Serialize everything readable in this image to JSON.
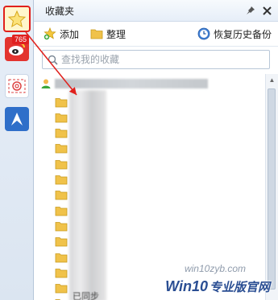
{
  "sidebar": {
    "weibo_badge": "765",
    "items": [
      {
        "name": "favorites",
        "icon": "star-icon",
        "color": "#f5c518"
      },
      {
        "name": "weibo",
        "icon": "weibo-icon",
        "color": "#e3342f"
      },
      {
        "name": "mail",
        "icon": "mail-icon",
        "color": "#d9534f"
      },
      {
        "name": "qq",
        "icon": "qq-icon",
        "color": "#2f6fc9"
      }
    ]
  },
  "header": {
    "title": "收藏夹",
    "pin_icon": "pin-icon",
    "close_icon": "close-icon"
  },
  "toolbar": {
    "add_label": "添加",
    "organize_label": "整理",
    "restore_label": "恢复历史备份"
  },
  "search": {
    "placeholder": "查找我的收藏",
    "value": ""
  },
  "tree": {
    "root": {
      "icon": "user-icon"
    },
    "folder_count": 14,
    "last_label": "已同步"
  },
  "watermark": {
    "url": "win10zyb.com",
    "brand": "Win10",
    "brand_cn": "专业版官网"
  },
  "colors": {
    "highlight": "#e0201c",
    "folder": "#f0c24a",
    "accent": "#2a4e93"
  }
}
